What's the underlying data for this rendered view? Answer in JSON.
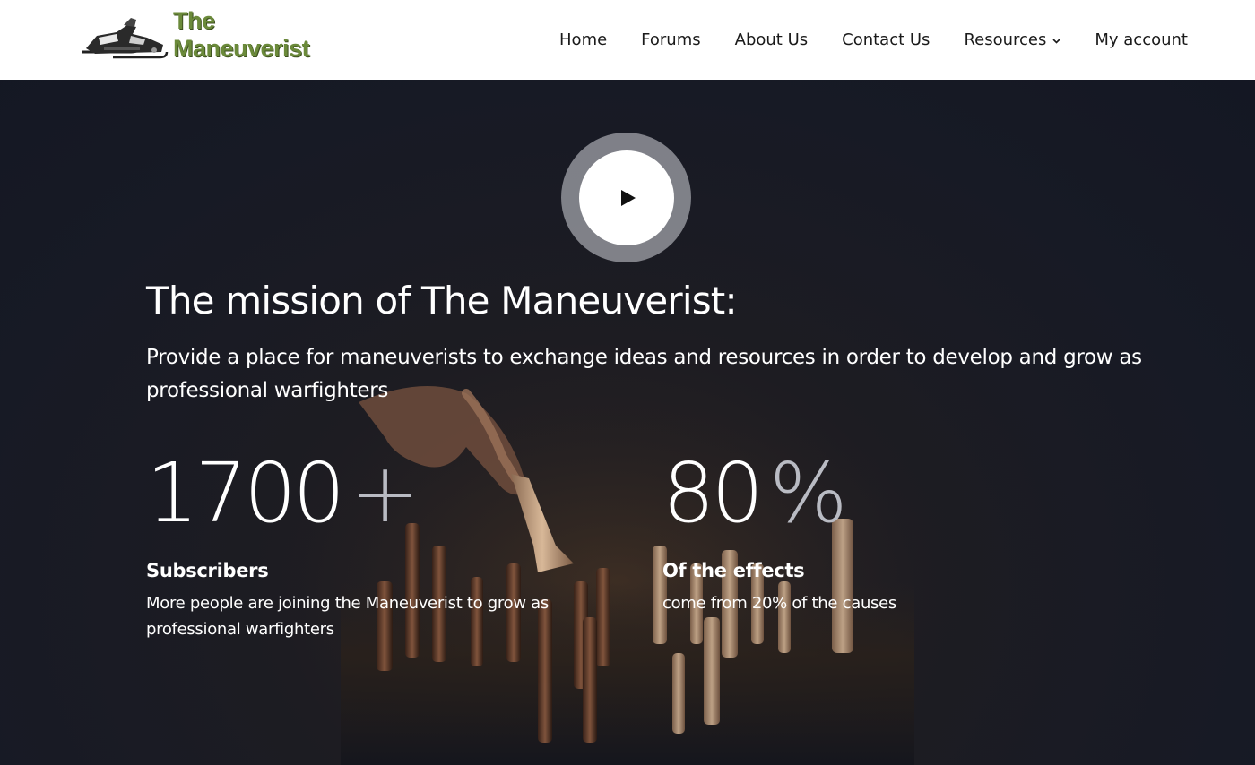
{
  "header": {
    "logo": {
      "line1": "The",
      "line2": "Maneuverist",
      "image": "snowmobile-logo"
    },
    "nav": [
      {
        "label": "Home"
      },
      {
        "label": "Forums"
      },
      {
        "label": "About Us"
      },
      {
        "label": "Contact Us"
      },
      {
        "label": "Resources",
        "icon": "chevron-down-icon",
        "chevron": "⌄"
      },
      {
        "label": "My account"
      }
    ]
  },
  "hero": {
    "play_icon": "play-icon",
    "title": "The mission of The Maneuverist:",
    "description": "Provide a place for maneuverists to exchange ideas and resources in order to develop and grow as professional warfighters",
    "stats": [
      {
        "number": "1700",
        "suffix": "+",
        "label": "Subscribers",
        "text": "More people are joining the Maneuverist to grow as professional warfighters"
      },
      {
        "number": "80",
        "suffix": "%",
        "label": "Of the effects",
        "text": "come from 20% of the causes"
      }
    ],
    "background": "chess-pieces-hand-photo"
  },
  "colors": {
    "logo_green": "#6b8a3a",
    "hero_bg": "#171a25",
    "nav_text": "#1a1a1a"
  }
}
